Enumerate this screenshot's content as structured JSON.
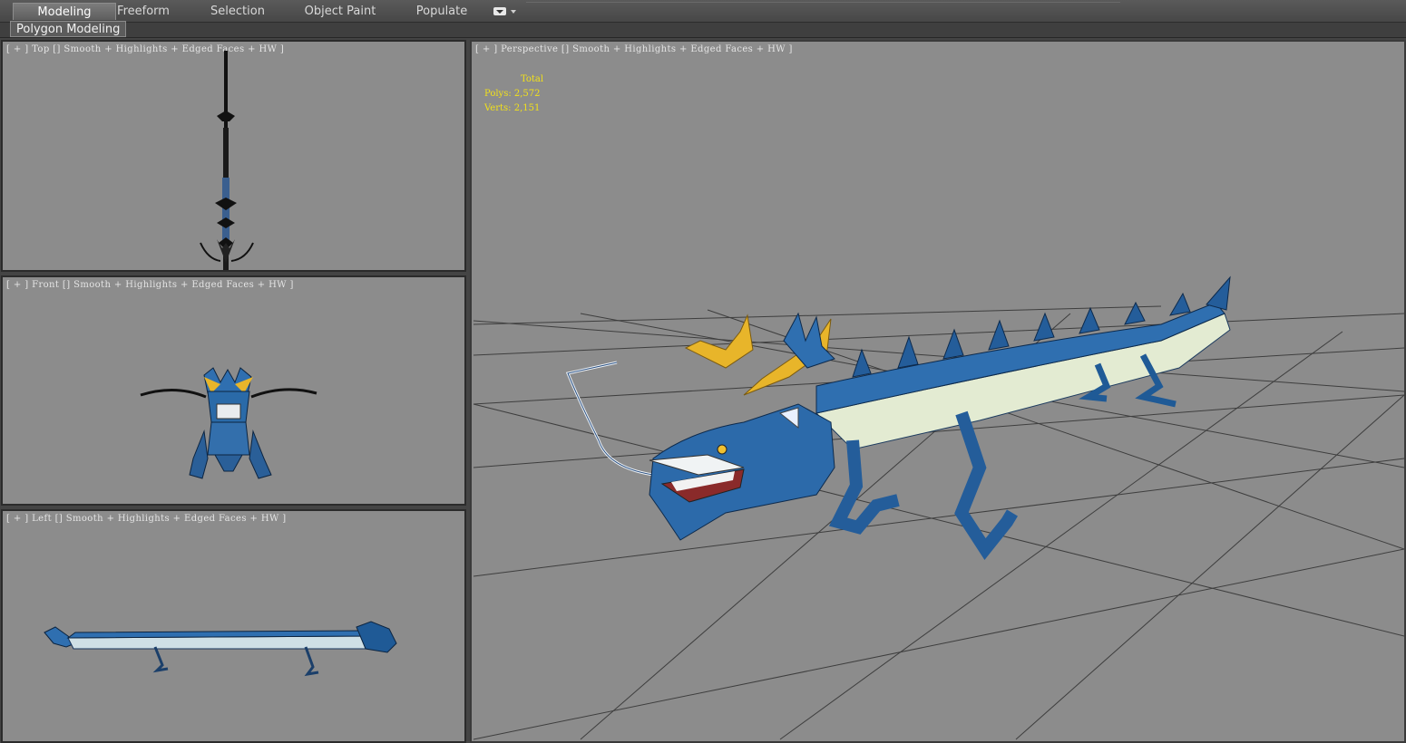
{
  "ribbon": {
    "tabs": [
      {
        "label": "Modeling",
        "active": true
      },
      {
        "label": "Freeform",
        "active": false
      },
      {
        "label": "Selection",
        "active": false
      },
      {
        "label": "Object Paint",
        "active": false
      },
      {
        "label": "Populate",
        "active": false
      }
    ],
    "menu_icon": "dropdown-menu-icon",
    "panel_label": "Polygon Modeling"
  },
  "viewports": {
    "top": {
      "label": "[ + ] Top [] Smooth + Highlights + Edged Faces + HW ]"
    },
    "front": {
      "label": "[ + ] Front [] Smooth + Highlights + Edged Faces + HW ]"
    },
    "left": {
      "label": "[ + ] Left [] Smooth + Highlights + Edged Faces + HW ]"
    },
    "perspective": {
      "label": "[ + ] Perspective [] Smooth + Highlights + Edged Faces + HW ]",
      "stats": {
        "title": "Total",
        "polys": "Polys: 2,572",
        "verts": "Verts: 2,151"
      }
    }
  },
  "colors": {
    "viewport_bg": "#8c8c8c",
    "stats_text": "#f2e11a",
    "dragon_blue": "#2f6fb0",
    "dragon_belly": "#e6ebc8",
    "dragon_horn": "#e8b52a"
  }
}
